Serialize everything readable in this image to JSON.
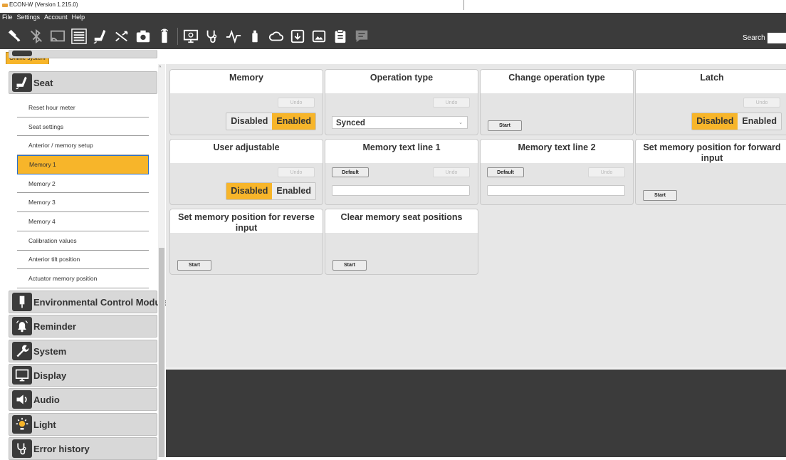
{
  "window": {
    "title": "ECON-W (Version 1.215.0)"
  },
  "menubar": [
    "File",
    "Settings",
    "Account",
    "Help"
  ],
  "toolbar": {
    "icons": [
      "bluetooth-connect-icon",
      "bluetooth-off-icon",
      "cast-icon",
      "list-icon",
      "seat-icon",
      "shuffle-icon",
      "camera-icon",
      "battery-icon",
      "monitor-icon",
      "stethoscope-icon",
      "pulse-icon",
      "bottle-icon",
      "cloud-icon",
      "download-icon",
      "image-icon",
      "clipboard-icon",
      "chat-icon"
    ],
    "search_label": "Search",
    "search_value": ""
  },
  "system_tab": "Online system",
  "colors": {
    "accent": "#f7b52a",
    "dark": "#3b3b3b",
    "panel": "#e7e7e7"
  },
  "sidebar": {
    "seat_label": "Seat",
    "seat_items": [
      "Reset hour meter",
      "Seat settings",
      "Anterior / memory setup",
      "Memory 1",
      "Memory 2",
      "Memory 3",
      "Memory 4",
      "Calibration values",
      "Anterior tilt position",
      "Actuator memory position"
    ],
    "active_item": "Memory 1",
    "sections": [
      {
        "label": "Environmental Control Module",
        "icon": "ecm-icon"
      },
      {
        "label": "Reminder",
        "icon": "bell-icon"
      },
      {
        "label": "System",
        "icon": "wrench-icon"
      },
      {
        "label": "Display",
        "icon": "display-icon"
      },
      {
        "label": "Audio",
        "icon": "speaker-icon"
      },
      {
        "label": "Light",
        "icon": "light-icon"
      },
      {
        "label": "Error history",
        "icon": "stethoscope-icon"
      }
    ]
  },
  "cards": {
    "memory": {
      "title": "Memory",
      "undo": "Undo",
      "off": "Disabled",
      "on": "Enabled",
      "value": "Enabled"
    },
    "operation_type": {
      "title": "Operation type",
      "undo": "Undo",
      "value": "Synced"
    },
    "change_operation_type": {
      "title": "Change operation type",
      "start": "Start"
    },
    "latch": {
      "title": "Latch",
      "undo": "Undo",
      "off": "Disabled",
      "on": "Enabled",
      "value": "Disabled"
    },
    "user_adjustable": {
      "title": "User adjustable",
      "undo": "Undo",
      "off": "Disabled",
      "on": "Enabled",
      "value": "Disabled"
    },
    "memory_text_1": {
      "title": "Memory text line 1",
      "default": "Default",
      "undo": "Undo",
      "value": ""
    },
    "memory_text_2": {
      "title": "Memory text line 2",
      "default": "Default",
      "undo": "Undo",
      "value": ""
    },
    "set_forward": {
      "title": "Set memory position for forward input",
      "start": "Start"
    },
    "set_reverse": {
      "title": "Set memory position for reverse input",
      "start": "Start"
    },
    "clear_positions": {
      "title": "Clear memory seat positions",
      "start": "Start"
    }
  }
}
